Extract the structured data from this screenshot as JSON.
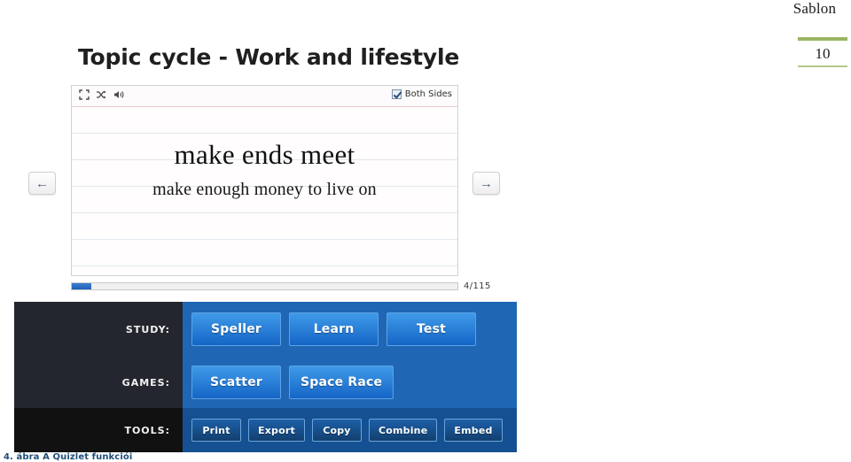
{
  "document": {
    "header_title": "Sablon",
    "page_number": "10",
    "caption": "4. ábra A Quizlet funkciói",
    "accent_green": "#9ab563",
    "caption_color": "#1f4e79"
  },
  "figure": {
    "title": "Topic cycle - Work and lifestyle"
  },
  "flashcard": {
    "toolbar": {
      "icons": [
        {
          "name": "fullscreen-icon"
        },
        {
          "name": "shuffle-icon"
        },
        {
          "name": "audio-icon"
        }
      ],
      "both_sides_label": "Both Sides",
      "both_sides_checked": true
    },
    "term": "make ends meet",
    "definition": "make enough money to live on",
    "nav": {
      "prev_label": "←",
      "next_label": "→"
    },
    "progress": {
      "current": "4",
      "total": "115",
      "label": "4/115",
      "percent": 5,
      "fill_color": "#2e6fc4"
    }
  },
  "action_panel": {
    "rows": [
      {
        "label": "STUDY:",
        "style": "big",
        "buttons": [
          {
            "label": "Speller"
          },
          {
            "label": "Learn"
          },
          {
            "label": "Test"
          }
        ]
      },
      {
        "label": "GAMES:",
        "style": "big",
        "buttons": [
          {
            "label": "Scatter"
          },
          {
            "label": "Space Race"
          }
        ]
      },
      {
        "label": "TOOLS:",
        "style": "small",
        "buttons": [
          {
            "label": "Print"
          },
          {
            "label": "Export"
          },
          {
            "label": "Copy"
          },
          {
            "label": "Combine"
          },
          {
            "label": "Embed"
          }
        ]
      }
    ]
  }
}
